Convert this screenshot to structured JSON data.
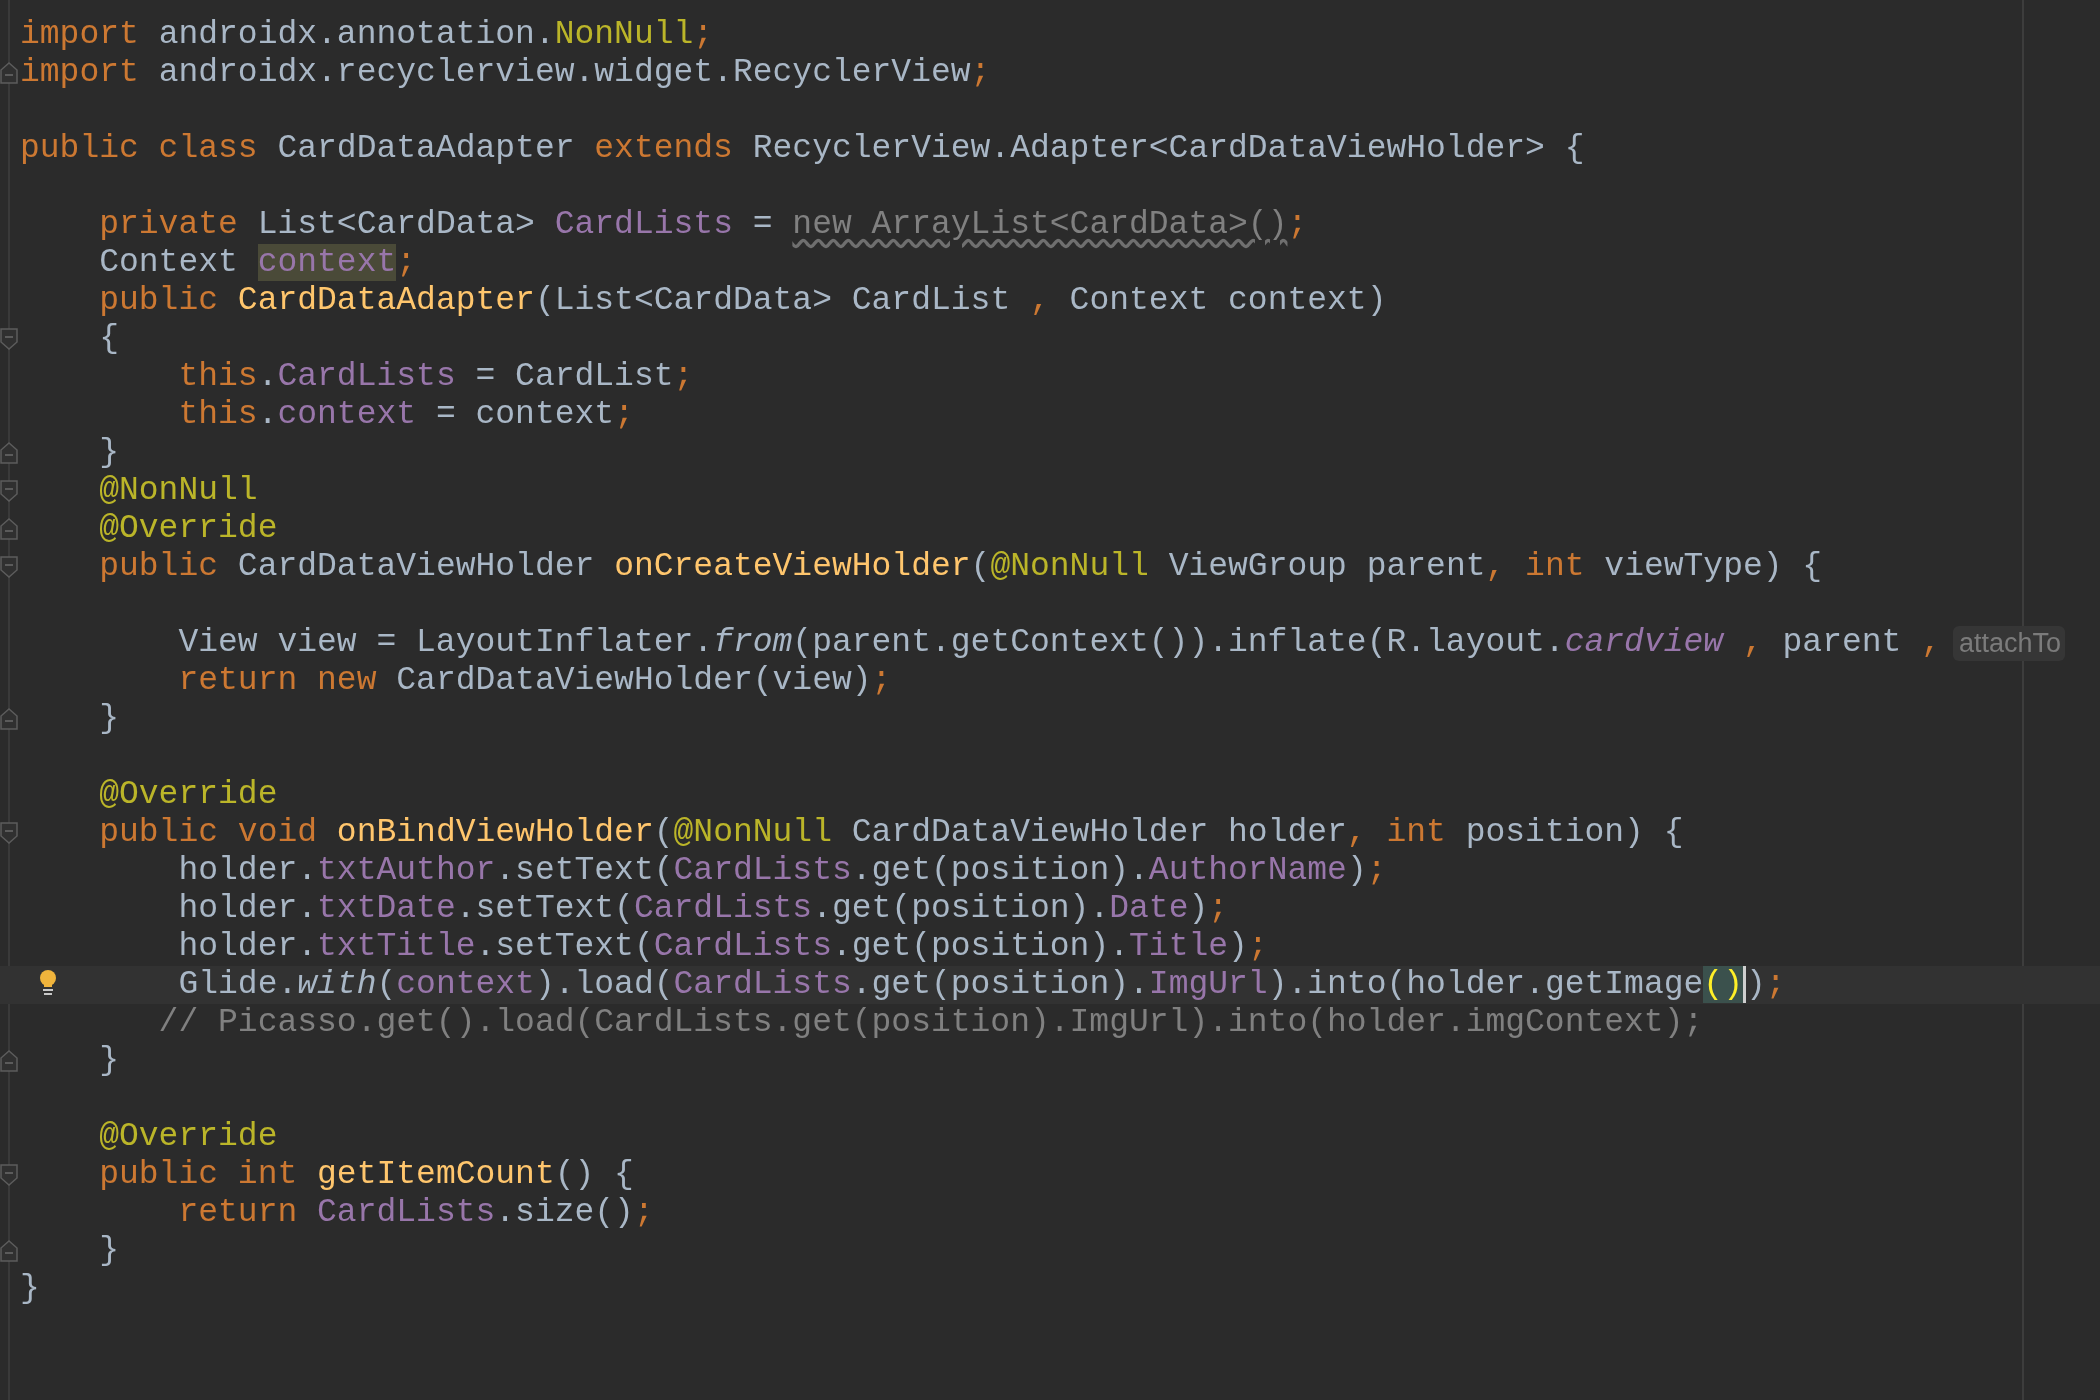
{
  "editor": {
    "lines": [
      {
        "current": false,
        "tokens": [
          {
            "kind": "kw",
            "text": "import"
          },
          {
            "kind": "plain",
            "text": " androidx.annotation."
          },
          {
            "kind": "annot",
            "text": "NonNull"
          },
          {
            "kind": "kw",
            "text": ";"
          }
        ]
      },
      {
        "current": false,
        "gutter_mark": {
          "kind": "fold-end"
        },
        "tokens": [
          {
            "kind": "kw",
            "text": "import"
          },
          {
            "kind": "plain",
            "text": " androidx.recyclerview.widget.RecyclerView"
          },
          {
            "kind": "kw",
            "text": ";"
          }
        ]
      },
      {
        "current": false
      },
      {
        "current": false,
        "tokens": [
          {
            "kind": "kw",
            "text": "public class"
          },
          {
            "kind": "plain",
            "text": " CardDataAdapter "
          },
          {
            "kind": "kw",
            "text": "extends"
          },
          {
            "kind": "plain",
            "text": " RecyclerView.Adapter<CardDataViewHolder> {"
          }
        ]
      },
      {
        "current": false
      },
      {
        "current": false,
        "tokens": [
          {
            "kind": "kw",
            "text": "    private"
          },
          {
            "kind": "plain",
            "text": " List<CardData> "
          },
          {
            "kind": "field",
            "text": "CardLists"
          },
          {
            "kind": "plain",
            "text": " = "
          },
          {
            "kind": "warn",
            "text": "new ArrayList<CardData>()"
          },
          {
            "kind": "kw",
            "text": ";"
          }
        ]
      },
      {
        "current": false,
        "tokens": [
          {
            "kind": "plain",
            "text": "    Context "
          },
          {
            "kind": "usage",
            "text": "context"
          },
          {
            "kind": "kw",
            "text": ";"
          }
        ]
      },
      {
        "current": false,
        "tokens": [
          {
            "kind": "kw",
            "text": "    public "
          },
          {
            "kind": "decl",
            "text": "CardDataAdapter"
          },
          {
            "kind": "plain",
            "text": "(List<CardData> CardList "
          },
          {
            "kind": "kw",
            "text": ","
          },
          {
            "kind": "plain",
            "text": " Context context)"
          }
        ]
      },
      {
        "current": false,
        "gutter_mark": {
          "kind": "fold-start"
        },
        "tokens": [
          {
            "kind": "plain",
            "text": "    {"
          }
        ]
      },
      {
        "current": false,
        "tokens": [
          {
            "kind": "kw",
            "text": "        this"
          },
          {
            "kind": "plain",
            "text": "."
          },
          {
            "kind": "field",
            "text": "CardLists"
          },
          {
            "kind": "plain",
            "text": " = CardList"
          },
          {
            "kind": "kw",
            "text": ";"
          }
        ]
      },
      {
        "current": false,
        "tokens": [
          {
            "kind": "kw",
            "text": "        this"
          },
          {
            "kind": "plain",
            "text": "."
          },
          {
            "kind": "field",
            "text": "context"
          },
          {
            "kind": "plain",
            "text": " = context"
          },
          {
            "kind": "kw",
            "text": ";"
          }
        ]
      },
      {
        "current": false,
        "gutter_mark": {
          "kind": "fold-end"
        },
        "tokens": [
          {
            "kind": "plain",
            "text": "    }"
          }
        ]
      },
      {
        "current": false,
        "gutter_mark": {
          "kind": "fold-start"
        },
        "tokens": [
          {
            "kind": "annot",
            "text": "    @NonNull"
          }
        ]
      },
      {
        "current": false,
        "gutter_mark": {
          "kind": "fold-end"
        },
        "tokens": [
          {
            "kind": "annot",
            "text": "    @Override"
          }
        ]
      },
      {
        "current": false,
        "gutter_mark": {
          "kind": "fold-start"
        },
        "tokens": [
          {
            "kind": "kw",
            "text": "    public"
          },
          {
            "kind": "plain",
            "text": " CardDataViewHolder "
          },
          {
            "kind": "decl",
            "text": "onCreateViewHolder"
          },
          {
            "kind": "plain",
            "text": "("
          },
          {
            "kind": "annot",
            "text": "@NonNull"
          },
          {
            "kind": "plain",
            "text": " ViewGroup parent"
          },
          {
            "kind": "kw",
            "text": ", int"
          },
          {
            "kind": "plain",
            "text": " viewType) {"
          }
        ]
      },
      {
        "current": false
      },
      {
        "current": false,
        "hint": "attachTo",
        "tokens": [
          {
            "kind": "plain",
            "text": "        View view = LayoutInflater."
          },
          {
            "kind": "italic",
            "text": "from"
          },
          {
            "kind": "plain",
            "text": "(parent.getContext()).inflate(R.layout."
          },
          {
            "kind": "field-italic",
            "text": "cardview"
          },
          {
            "kind": "kw",
            "text": " ,"
          },
          {
            "kind": "plain",
            "text": " parent "
          },
          {
            "kind": "kw",
            "text": ","
          }
        ]
      },
      {
        "current": false,
        "tokens": [
          {
            "kind": "kw",
            "text": "        return new"
          },
          {
            "kind": "plain",
            "text": " CardDataViewHolder(view)"
          },
          {
            "kind": "kw",
            "text": ";"
          }
        ]
      },
      {
        "current": false,
        "gutter_mark": {
          "kind": "fold-end"
        },
        "tokens": [
          {
            "kind": "plain",
            "text": "    }"
          }
        ]
      },
      {
        "current": false
      },
      {
        "current": false,
        "tokens": [
          {
            "kind": "annot",
            "text": "    @Override"
          }
        ]
      },
      {
        "current": false,
        "gutter_mark": {
          "kind": "fold-start"
        },
        "tokens": [
          {
            "kind": "kw",
            "text": "    public void "
          },
          {
            "kind": "decl",
            "text": "onBindViewHolder"
          },
          {
            "kind": "plain",
            "text": "("
          },
          {
            "kind": "annot",
            "text": "@NonNull"
          },
          {
            "kind": "plain",
            "text": " CardDataViewHolder holder"
          },
          {
            "kind": "kw",
            "text": ", int"
          },
          {
            "kind": "plain",
            "text": " position) {"
          }
        ]
      },
      {
        "current": false,
        "tokens": [
          {
            "kind": "plain",
            "text": "        holder."
          },
          {
            "kind": "field",
            "text": "txtAuthor"
          },
          {
            "kind": "plain",
            "text": ".setText("
          },
          {
            "kind": "field",
            "text": "CardLists"
          },
          {
            "kind": "plain",
            "text": ".get(position)."
          },
          {
            "kind": "field",
            "text": "AuthorName"
          },
          {
            "kind": "plain",
            "text": ")"
          },
          {
            "kind": "kw",
            "text": ";"
          }
        ]
      },
      {
        "current": false,
        "tokens": [
          {
            "kind": "plain",
            "text": "        holder."
          },
          {
            "kind": "field",
            "text": "txtDate"
          },
          {
            "kind": "plain",
            "text": ".setText("
          },
          {
            "kind": "field",
            "text": "CardLists"
          },
          {
            "kind": "plain",
            "text": ".get(position)."
          },
          {
            "kind": "field",
            "text": "Date"
          },
          {
            "kind": "plain",
            "text": ")"
          },
          {
            "kind": "kw",
            "text": ";"
          }
        ]
      },
      {
        "current": false,
        "tokens": [
          {
            "kind": "plain",
            "text": "        holder."
          },
          {
            "kind": "field",
            "text": "txtTitle"
          },
          {
            "kind": "plain",
            "text": ".setText("
          },
          {
            "kind": "field",
            "text": "CardLists"
          },
          {
            "kind": "plain",
            "text": ".get(position)."
          },
          {
            "kind": "field",
            "text": "Title"
          },
          {
            "kind": "plain",
            "text": ")"
          },
          {
            "kind": "kw",
            "text": ";"
          }
        ]
      },
      {
        "current": true,
        "tokens": [
          {
            "kind": "plain",
            "text": "        Glide."
          },
          {
            "kind": "italic",
            "text": "with"
          },
          {
            "kind": "plain",
            "text": "("
          },
          {
            "kind": "field",
            "text": "context"
          },
          {
            "kind": "plain",
            "text": ").load("
          },
          {
            "kind": "field",
            "text": "CardLists"
          },
          {
            "kind": "plain",
            "text": ".get(position)."
          },
          {
            "kind": "field",
            "text": "ImgUrl"
          },
          {
            "kind": "plain",
            "text": ").into(holder.getImage"
          },
          {
            "kind": "match-caret",
            "text": "()"
          },
          {
            "kind": "plain",
            "text": ")"
          },
          {
            "kind": "kw",
            "text": ";"
          }
        ]
      },
      {
        "current": false,
        "tokens": [
          {
            "kind": "comment",
            "text": "       // Picasso.get().load(CardLists.get(position).ImgUrl).into(holder.imgContext);"
          }
        ]
      },
      {
        "current": false,
        "gutter_mark": {
          "kind": "fold-end"
        },
        "tokens": [
          {
            "kind": "plain",
            "text": "    }"
          }
        ]
      },
      {
        "current": false
      },
      {
        "current": false,
        "tokens": [
          {
            "kind": "annot",
            "text": "    @Override"
          }
        ]
      },
      {
        "current": false,
        "gutter_mark": {
          "kind": "fold-start"
        },
        "tokens": [
          {
            "kind": "kw",
            "text": "    public int "
          },
          {
            "kind": "decl",
            "text": "getItemCount"
          },
          {
            "kind": "plain",
            "text": "() {"
          }
        ]
      },
      {
        "current": false,
        "tokens": [
          {
            "kind": "kw",
            "text": "        return "
          },
          {
            "kind": "field",
            "text": "CardLists"
          },
          {
            "kind": "plain",
            "text": ".size()"
          },
          {
            "kind": "kw",
            "text": ";"
          }
        ]
      },
      {
        "current": false,
        "gutter_mark": {
          "kind": "fold-end"
        },
        "tokens": [
          {
            "kind": "plain",
            "text": "    }"
          }
        ]
      },
      {
        "current": false,
        "tokens": [
          {
            "kind": "plain",
            "text": "}"
          }
        ]
      }
    ]
  }
}
